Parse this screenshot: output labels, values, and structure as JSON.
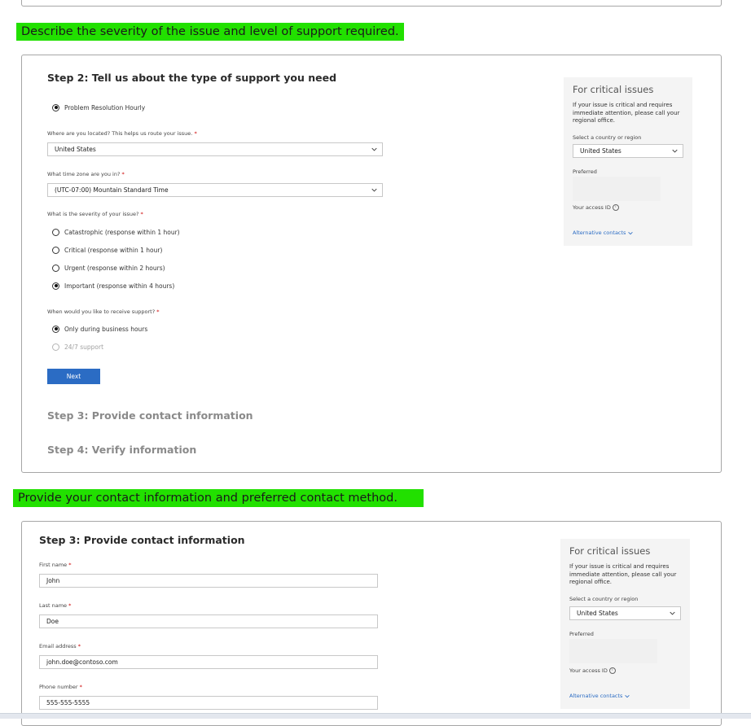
{
  "banners": {
    "severity": "Describe the severity of the issue and level of support required.",
    "contact": "Provide your contact information and preferred contact method."
  },
  "step2": {
    "title": "Step 2: Tell us about the type of support you need",
    "plan_option": "Problem Resolution Hourly",
    "location_label": "Where are you located? This helps us route your issue.",
    "location_value": "United States",
    "timezone_label": "What time zone are you in?",
    "timezone_value": "(UTC-07:00) Mountain Standard Time",
    "severity_label": "What is the severity of your issue?",
    "severity_options": [
      "Catastrophic (response within 1 hour)",
      "Critical (response within 1 hour)",
      "Urgent (response within 2 hours)",
      "Important (response within 4 hours)"
    ],
    "support_time_label": "When would you like to receive support?",
    "support_time_options": [
      "Only during business hours",
      "24/7 support"
    ],
    "next_label": "Next",
    "step3_collapsed": "Step 3: Provide contact information",
    "step4_collapsed": "Step 4: Verify information",
    "required_mark": "*"
  },
  "side_panel": {
    "title": "For critical issues",
    "text": "If your issue is critical and requires immediate attention, please call your regional office.",
    "region_label": "Select a country or region",
    "region_value": "United States",
    "preferred_label": "Preferred",
    "access_id_label": "Your access ID",
    "info_glyph": "i",
    "alt_contacts": "Alternative contacts"
  },
  "step3": {
    "title": "Step 3: Provide contact information",
    "first_name_label": "First name",
    "first_name_value": "John",
    "last_name_label": "Last name",
    "last_name_value": "Doe",
    "email_label": "Email address",
    "email_value": "john.doe@contoso.com",
    "phone_label": "Phone number",
    "phone_value": "555-555-5555",
    "required_mark": "*"
  },
  "colors": {
    "banner": "#22e000",
    "primary_button": "#2b6cc4",
    "link": "#2b6cc4",
    "required": "#cc0000"
  }
}
